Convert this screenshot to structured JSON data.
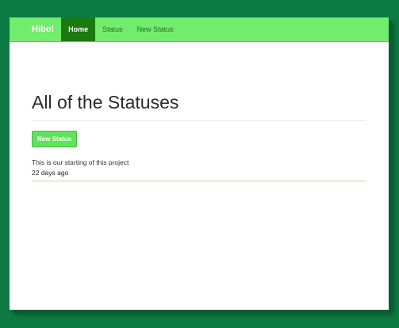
{
  "navbar": {
    "brand": "Hibo!",
    "items": [
      {
        "label": "Home",
        "active": true
      },
      {
        "label": "Status",
        "active": false
      },
      {
        "label": "New Status",
        "active": false
      }
    ]
  },
  "main": {
    "title": "All of the Statuses",
    "new_status_button": "New Status",
    "statuses": [
      {
        "body": "This is our starting of this project",
        "time": "22 days ago"
      }
    ]
  },
  "colors": {
    "background": "#0d7a44",
    "navbar": "#71ec6b",
    "nav_active": "#1a7a10",
    "button": "#5fe35a"
  }
}
